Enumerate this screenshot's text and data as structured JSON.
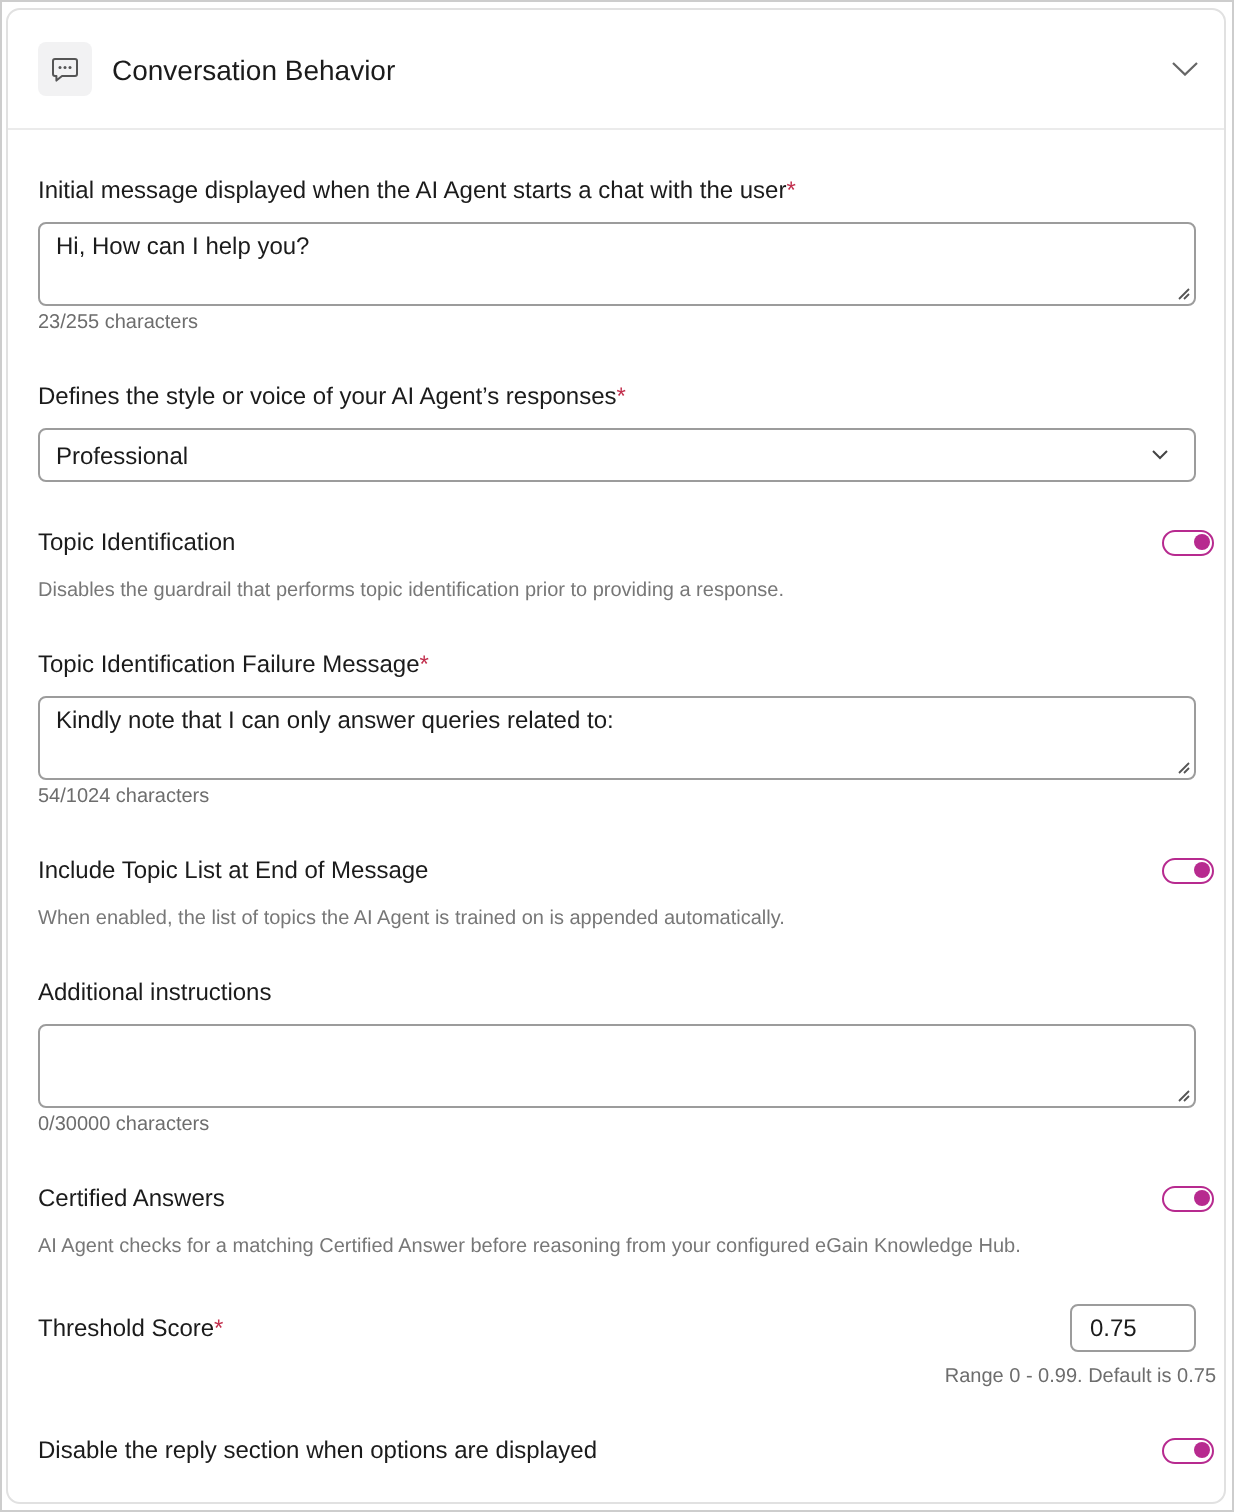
{
  "section": {
    "title": "Conversation Behavior",
    "expanded": true
  },
  "fields": [
    {
      "kind": "textarea",
      "label": "Initial message displayed when the AI Agent starts a chat with the user",
      "required_mark": "*",
      "value": "Hi, How can I help you?",
      "counter": "23/255 characters"
    },
    {
      "kind": "select",
      "label": "Defines the style or voice of your AI Agent’s responses",
      "required_mark": "*",
      "value": "Professional"
    },
    {
      "kind": "toggle",
      "label": "Topic Identification",
      "on": true,
      "description": "Disables the guardrail that performs topic identification prior to providing a response."
    },
    {
      "kind": "textarea",
      "label": "Topic Identification Failure Message",
      "required_mark": "*",
      "value": "Kindly note that I can only answer queries related to:",
      "counter": "54/1024 characters"
    },
    {
      "kind": "toggle",
      "label": "Include Topic List at End of Message",
      "on": true,
      "description": "When enabled, the list of topics the AI Agent is trained on is appended automatically."
    },
    {
      "kind": "textarea",
      "label": "Additional instructions",
      "counter": "0/30000 characters"
    },
    {
      "kind": "toggle",
      "label": "Certified Answers",
      "on": true,
      "description": "AI Agent checks for a matching Certified Answer before reasoning from your configured eGain Knowledge Hub."
    },
    {
      "kind": "number",
      "label": "Threshold Score",
      "required_mark": "*",
      "value": "0.75",
      "hint": "Range 0 - 0.99. Default is 0.75"
    },
    {
      "kind": "toggle",
      "label": "Disable the reply section when options are displayed",
      "on": true
    }
  ]
}
